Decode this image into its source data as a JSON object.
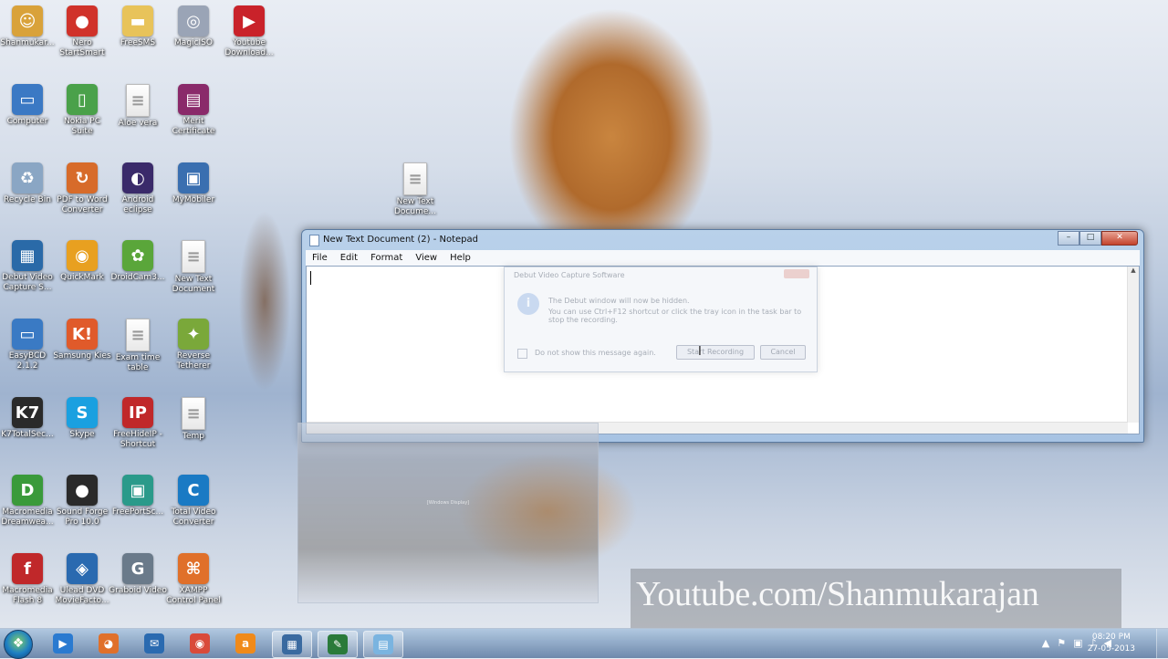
{
  "desktop_icons": [
    {
      "label": "Shanmukar...",
      "icon": "user-folder-icon",
      "color": "#d9a23a",
      "glyph": "☺"
    },
    {
      "label": "Nero StartSmart",
      "icon": "nero-icon",
      "color": "#d0322a",
      "glyph": "●"
    },
    {
      "label": "FreeSMS",
      "icon": "folder-icon",
      "color": "#e8c35a",
      "glyph": "▬"
    },
    {
      "label": "MagicISO",
      "icon": "disc-icon",
      "color": "#9aa4b6",
      "glyph": "◎"
    },
    {
      "label": "Youtube Download...",
      "icon": "youtube-downloader-icon",
      "color": "#c9222a",
      "glyph": "▶"
    },
    {
      "label": "Computer",
      "icon": "computer-icon",
      "color": "#3b79c4",
      "glyph": "▭"
    },
    {
      "label": "Nokia PC Suite",
      "icon": "nokia-icon",
      "color": "#4aa14a",
      "glyph": "▯"
    },
    {
      "label": "Aloe vera",
      "icon": "text-file-icon",
      "color": "#ffffff",
      "glyph": "≡"
    },
    {
      "label": "Merit Certificate",
      "icon": "winrar-icon",
      "color": "#8a2a6a",
      "glyph": "▤"
    },
    {
      "label": "Recycle Bin",
      "icon": "recycle-bin-icon",
      "color": "#8aa6c4",
      "glyph": "♻"
    },
    {
      "label": "PDF to Word Converter",
      "icon": "pdf-converter-icon",
      "color": "#d76b2a",
      "glyph": "↻"
    },
    {
      "label": "Android eclipse",
      "icon": "eclipse-icon",
      "color": "#3a2a6a",
      "glyph": "◐"
    },
    {
      "label": "MyMobiler",
      "icon": "mymobiler-icon",
      "color": "#3a6fb0",
      "glyph": "▣"
    },
    {
      "label": "Debut Video Capture S...",
      "icon": "debut-video-icon",
      "color": "#2a6aa8",
      "glyph": "▦"
    },
    {
      "label": "QuickMark",
      "icon": "quickmark-icon",
      "color": "#e8a020",
      "glyph": "◉"
    },
    {
      "label": "DroidCam3...",
      "icon": "droidcam-icon",
      "color": "#5aa63a",
      "glyph": "✿"
    },
    {
      "label": "New Text Document",
      "icon": "text-file-icon",
      "color": "#ffffff",
      "glyph": "≡"
    },
    {
      "label": "EasyBCD 2.1.2",
      "icon": "easybcd-icon",
      "color": "#3a7ac4",
      "glyph": "▭"
    },
    {
      "label": "Samsung Kies",
      "icon": "kies-icon",
      "color": "#e05a2a",
      "glyph": "K!"
    },
    {
      "label": "Exam time table",
      "icon": "text-file-icon",
      "color": "#ffffff",
      "glyph": "≡"
    },
    {
      "label": "Reverse Tetherer",
      "icon": "android-icon",
      "color": "#7aa83a",
      "glyph": "✦"
    },
    {
      "label": "K7TotalSec...",
      "icon": "k7-icon",
      "color": "#2a2a2a",
      "glyph": "K7"
    },
    {
      "label": "Skype",
      "icon": "skype-icon",
      "color": "#1aa0e0",
      "glyph": "S"
    },
    {
      "label": "FreeHideIP - Shortcut",
      "icon": "freehideip-icon",
      "color": "#c0282a",
      "glyph": "IP"
    },
    {
      "label": "Temp",
      "icon": "text-file-icon",
      "color": "#ffffff",
      "glyph": "≡"
    },
    {
      "label": "Macromedia Dreamwea...",
      "icon": "dreamweaver-icon",
      "color": "#3a9a3a",
      "glyph": "D"
    },
    {
      "label": "Sound Forge Pro 10.0",
      "icon": "sound-forge-icon",
      "color": "#2a2a2a",
      "glyph": "●"
    },
    {
      "label": "FreePortSc...",
      "icon": "freeportscanner-icon",
      "color": "#2a9a8a",
      "glyph": "▣"
    },
    {
      "label": "Total Video Converter",
      "icon": "total-video-icon",
      "color": "#1a7ac4",
      "glyph": "C"
    },
    {
      "label": "Macromedia Flash 8",
      "icon": "flash-icon",
      "color": "#c0282a",
      "glyph": "f"
    },
    {
      "label": "Ulead DVD MovieFacto...",
      "icon": "ulead-icon",
      "color": "#2a6ab0",
      "glyph": "◈"
    },
    {
      "label": "Graboid Video",
      "icon": "graboid-icon",
      "color": "#6a7a8a",
      "glyph": "G"
    },
    {
      "label": "XAMPP Control Panel",
      "icon": "xampp-icon",
      "color": "#e0702a",
      "glyph": "⌘"
    },
    {
      "label": "New Text Docume...",
      "icon": "text-file-icon",
      "color": "#ffffff",
      "glyph": "≡"
    }
  ],
  "notepad": {
    "title": "New Text Document (2) - Notepad",
    "menu": [
      "File",
      "Edit",
      "Format",
      "View",
      "Help"
    ],
    "content": "",
    "controls": {
      "minimize": "–",
      "maximize": "□",
      "close": "✕"
    }
  },
  "debut_dialog": {
    "title": "Debut Video Capture Software",
    "message_line1": "The Debut window will now be hidden.",
    "message_line2": "You can use Ctrl+F12 shortcut or click the tray icon in the task bar to stop the recording.",
    "checkbox_label": "Do not show this message again.",
    "start_button": "Start Recording",
    "cancel_button": "Cancel"
  },
  "ghost_window": {
    "text": "[Windows Display]"
  },
  "watermark": "Youtube.com/Shanmukarajan",
  "taskbar": {
    "apps": [
      {
        "name": "ie",
        "icon": "media-player-icon",
        "color": "#2a7ad0",
        "glyph": "▶"
      },
      {
        "name": "firefox",
        "icon": "firefox-icon",
        "color": "#e0702a",
        "glyph": "◕"
      },
      {
        "name": "messenger",
        "icon": "messenger-icon",
        "color": "#2a6ab0",
        "glyph": "✉"
      },
      {
        "name": "chrome",
        "icon": "chrome-icon",
        "color": "#d94a3a",
        "glyph": "◉"
      },
      {
        "name": "avast",
        "icon": "avast-icon",
        "color": "#f08a1a",
        "glyph": "a"
      },
      {
        "name": "debut",
        "icon": "debut-taskbar-icon",
        "color": "#3a6aa0",
        "glyph": "▦"
      },
      {
        "name": "pen",
        "icon": "pen-tool-icon",
        "color": "#2a7a3a",
        "glyph": "✎"
      },
      {
        "name": "notepad",
        "icon": "notepad-taskbar-icon",
        "color": "#7ab4e0",
        "glyph": "▤"
      }
    ],
    "tray": [
      "▲",
      "⚑",
      "▣",
      "♪",
      "◀"
    ],
    "time": "08:20 PM",
    "date": "27-05-2013"
  }
}
